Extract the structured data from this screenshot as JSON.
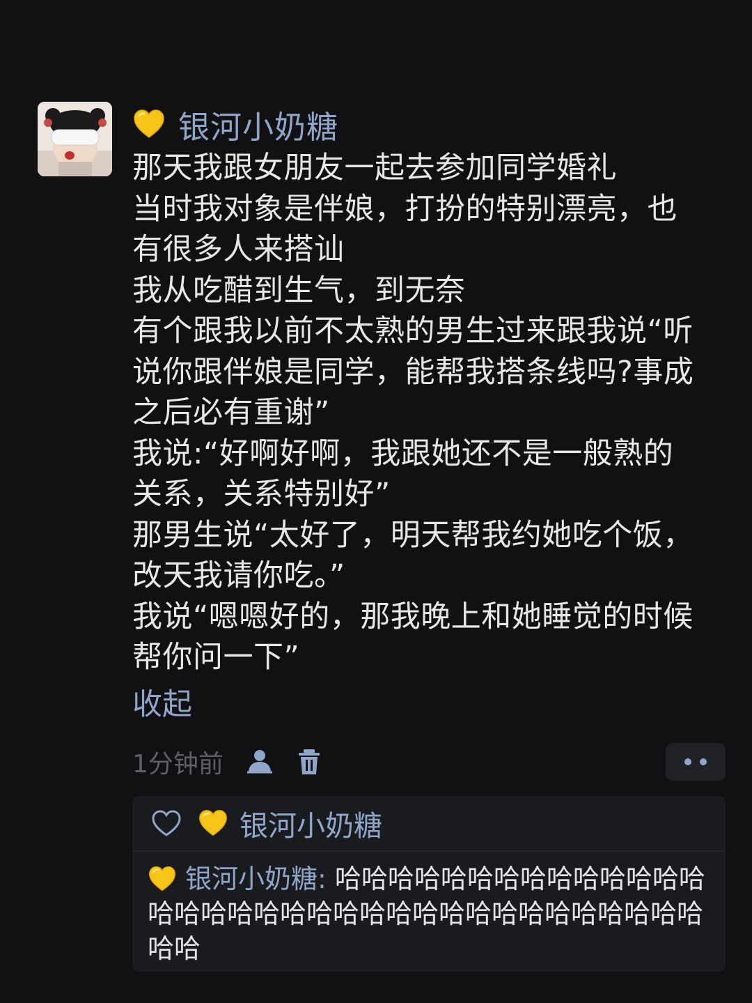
{
  "post": {
    "author": "银河小奶糖",
    "author_badge_icon": "yellow-heart-icon",
    "lines": [
      "那天我跟女朋友一起去参加同学婚礼",
      "当时我对象是伴娘，打扮的特别漂亮，也",
      "有很多人来搭讪",
      "我从吃醋到生气，到无奈",
      "有个跟我以前不太熟的男生过来跟我说“听",
      "说你跟伴娘是同学，能帮我搭条线吗?事成",
      "之后必有重谢”",
      "我说:“好啊好啊，我跟她还不是一般熟的",
      "关系，关系特别好”",
      "那男生说“太好了，明天帮我约她吃个饭，",
      "改天我请你吃。”",
      "我说“嗯嗯好的，那我晚上和她睡觉的时候",
      "帮你问一下”"
    ],
    "collapse_label": "收起",
    "timestamp": "1分钟前"
  },
  "icons": {
    "visibility": "person-visibility-icon",
    "delete": "trash-icon",
    "more": "more-dots-icon",
    "like": "heart-outline-icon"
  },
  "likes": {
    "liker": "银河小奶糖"
  },
  "comment": {
    "author": "银河小奶糖",
    "separator": ":",
    "text": " 哈哈哈哈哈哈哈哈哈哈哈哈哈哈哈哈哈哈哈哈哈哈哈哈哈哈哈哈哈哈哈哈哈哈哈哈哈"
  },
  "colors": {
    "background": "#111113",
    "link_blue": "#8fa6c9",
    "text": "#e7e7ea",
    "muted": "#5d5f66",
    "comment_bg": "#1a1b1f"
  }
}
